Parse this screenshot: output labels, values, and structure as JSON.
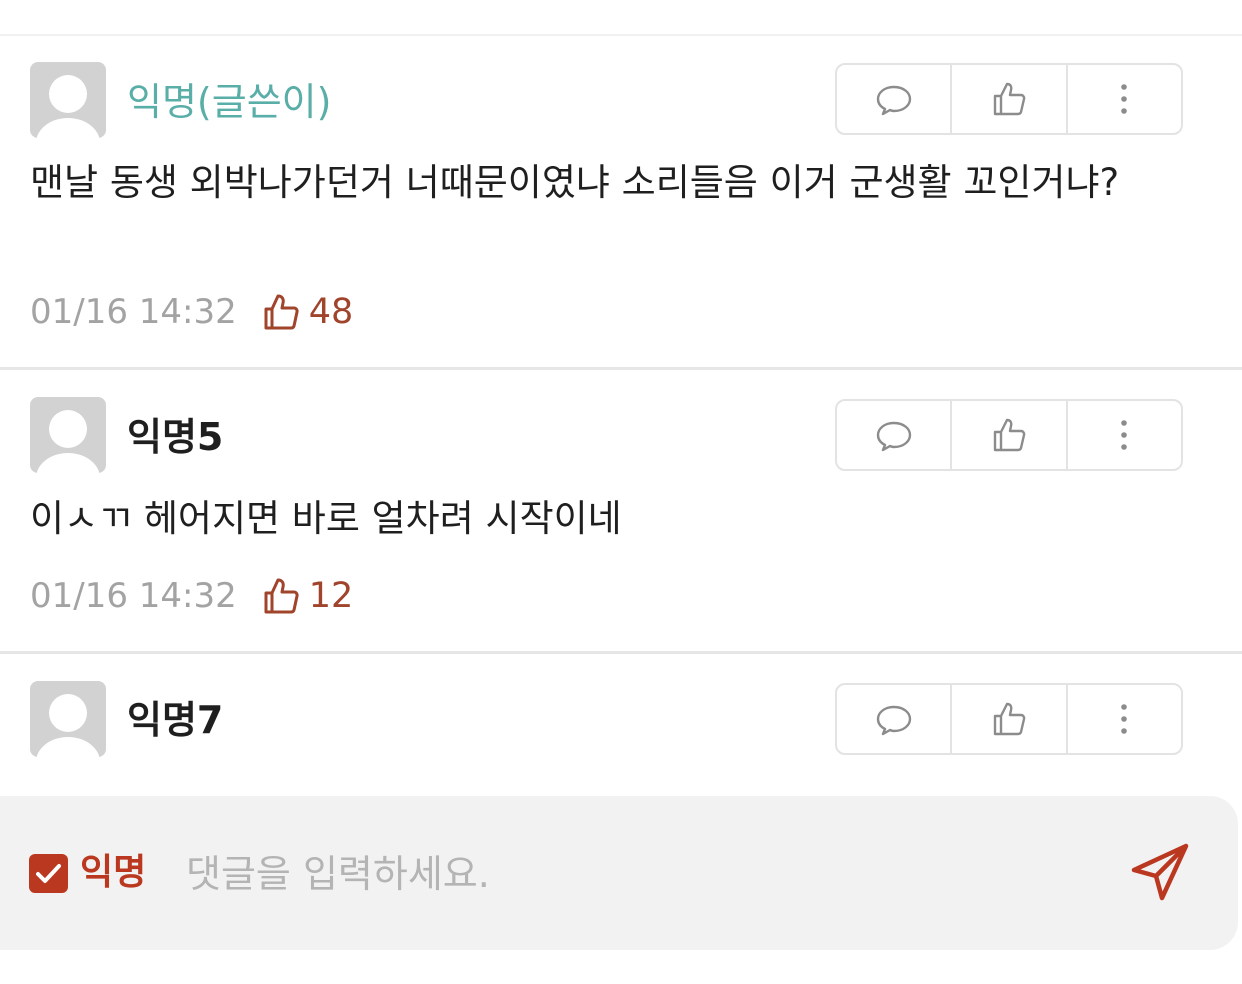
{
  "comments": [
    {
      "author": "익명(글쓴이)",
      "is_writer": true,
      "text": "맨날 동생 외박나가던거 너때문이였냐 소리들음 이거 군생활 꼬인거냐?",
      "time": "01/16 14:32",
      "likes": "48"
    },
    {
      "author": "익명5",
      "is_writer": false,
      "text": "이ㅅㄲ 헤어지면 바로 얼차려 시작이네",
      "time": "01/16 14:32",
      "likes": "12"
    },
    {
      "author": "익명7",
      "is_writer": false
    }
  ],
  "action_icons": [
    "reply-bubble-icon",
    "thumbs-up-icon",
    "more-vertical-icon"
  ],
  "input_bar": {
    "anonymous_checked": true,
    "anonymous_label": "익명",
    "placeholder": "댓글을 입력하세요.",
    "value": ""
  },
  "colors": {
    "writer_name": "#5aaea8",
    "accent": "#bb3820",
    "like_count": "#a0442c",
    "timestamp": "#a3a3a3"
  }
}
